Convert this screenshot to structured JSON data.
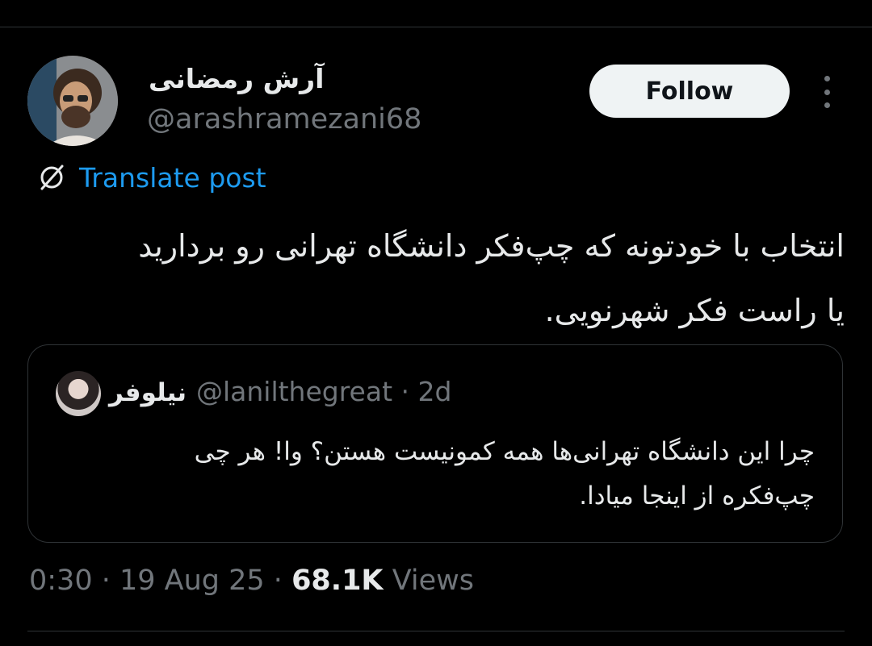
{
  "author": {
    "display_name": "آرش رمضانی",
    "handle": "@arashramezani68"
  },
  "follow_label": "Follow",
  "translate_label": "Translate post",
  "tweet": {
    "text_line1": "انتخاب با خودتونه که چپ‌فکر دانشگاه تهرانی رو بردارید",
    "text_line2": "یا راست فکر شهرنویی."
  },
  "quoted": {
    "display_name": "نیلوفر",
    "handle": "@lanilthegreat",
    "time": "2d",
    "text_line1": "چرا این دانشگاه تهرانی‌ها همه کمونیست هستن؟ وا! هر چی",
    "text_line2": "چپ‌فکره از اینجا میادا."
  },
  "meta": {
    "time": "0:30",
    "date": "19 Aug 25",
    "views_count": "68.1K",
    "views_label": "Views"
  },
  "colors": {
    "background": "#000000",
    "text": "#e7e9ea",
    "secondary": "#71767b",
    "link": "#1d9bf0",
    "border": "#2f3336"
  }
}
